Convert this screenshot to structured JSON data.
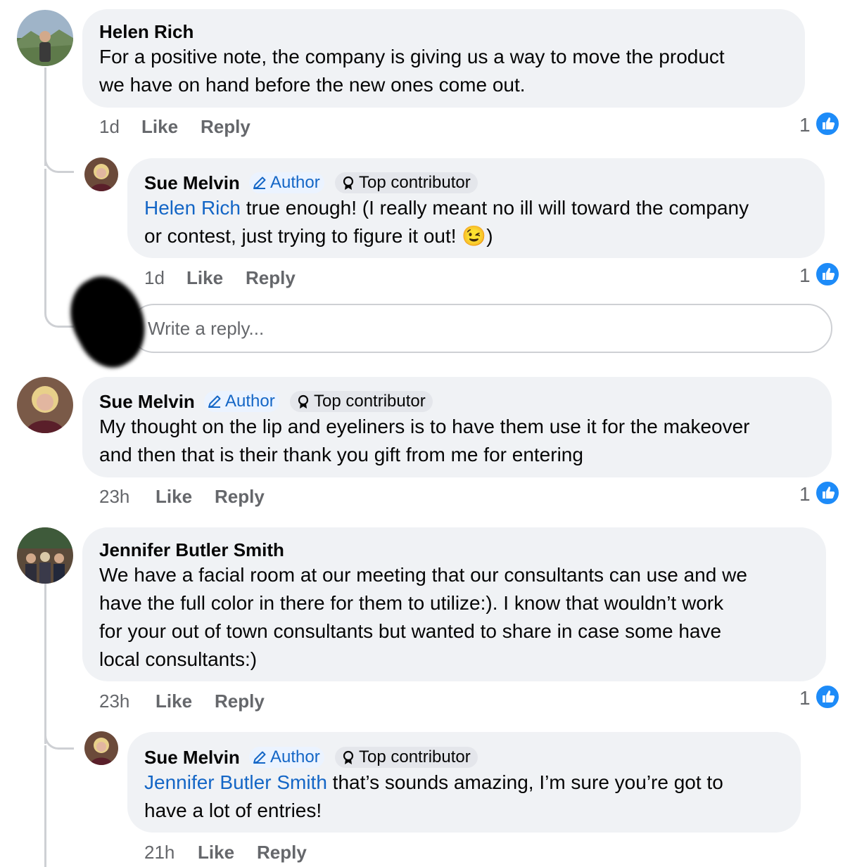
{
  "badges": {
    "author": "Author",
    "top": "Top contributor"
  },
  "actions": {
    "like": "Like",
    "reply": "Reply"
  },
  "reply_box": {
    "placeholder": "Write a reply..."
  },
  "comments": [
    {
      "name": "Helen Rich",
      "lines": [
        "For a positive note, the company is giving us a way to move the product",
        "we have on hand before the new ones come out."
      ],
      "time": "1d",
      "likes": "1"
    },
    {
      "name": "Sue Melvin",
      "mention": "Helen Rich",
      "lines": [
        " true enough! (I really meant no ill will toward the company",
        "or contest, just trying to figure it out! "
      ],
      "emoji": "😉",
      "tail": ")",
      "time": "1d",
      "likes": "1"
    },
    {
      "name": "Sue Melvin",
      "lines": [
        "My thought on the lip and eyeliners is to have them use it for the makeover",
        "and then that is their thank you gift from me for entering"
      ],
      "time": "23h",
      "likes": "1"
    },
    {
      "name": "Jennifer Butler Smith",
      "lines": [
        "We have a facial room at our meeting that our consultants can use and we",
        "have the full color in there for them to utilize:). I know that wouldn’t work",
        "for your out of town consultants but wanted to share in case some have",
        "local consultants:)"
      ],
      "time": "23h",
      "likes": "1"
    },
    {
      "name": "Sue Melvin",
      "mention": "Jennifer Butler Smith",
      "lines": [
        " that’s sounds amazing, I’m sure you’re got to",
        "have a lot of entries!"
      ],
      "time": "21h"
    }
  ]
}
